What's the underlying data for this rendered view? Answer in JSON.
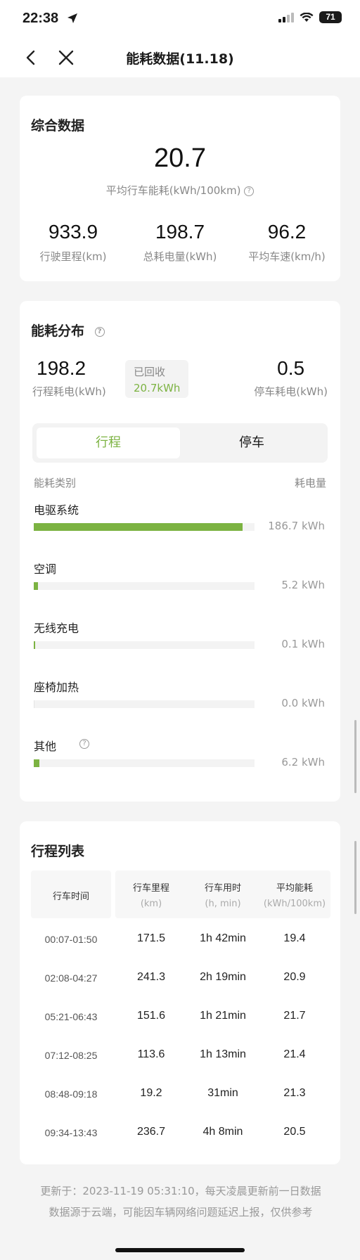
{
  "status": {
    "time": "22:38",
    "battery": "71"
  },
  "nav": {
    "title": "能耗数据(11.18)"
  },
  "summary": {
    "title": "综合数据",
    "avg_value": "20.7",
    "avg_label": "平均行车能耗(kWh/100km)",
    "stats": [
      {
        "value": "933.9",
        "label": "行驶里程(km)"
      },
      {
        "value": "198.7",
        "label": "总耗电量(kWh)"
      },
      {
        "value": "96.2",
        "label": "平均车速(km/h)"
      }
    ]
  },
  "distribution": {
    "title": "能耗分布",
    "drive_value": "198.2",
    "drive_label": "行程耗电(kWh)",
    "recycled_label": "已回收",
    "recycled_value": "20.7kWh",
    "park_value": "0.5",
    "park_label": "停车耗电(kWh)",
    "tabs": [
      "行程",
      "停车"
    ],
    "col_category": "能耗类别",
    "col_consumption": "耗电量",
    "items": [
      {
        "name": "电驱系统",
        "value": "186.7 kWh",
        "fill": 0.945
      },
      {
        "name": "空调",
        "value": "5.2 kWh",
        "fill": 0.02
      },
      {
        "name": "无线充电",
        "value": "0.1 kWh",
        "fill": 0.003
      },
      {
        "name": "座椅加热",
        "value": "0.0 kWh",
        "fill": 0
      },
      {
        "name": "其他",
        "value": "6.2 kWh",
        "fill": 0.024
      }
    ]
  },
  "trips": {
    "title": "行程列表",
    "headers": [
      {
        "main": "行车时间",
        "sub": ""
      },
      {
        "main": "行车里程",
        "sub": "(km)"
      },
      {
        "main": "行车用时",
        "sub": "(h, min)"
      },
      {
        "main": "平均能耗",
        "sub": "(kWh/100km)"
      }
    ],
    "rows": [
      [
        "00:07-01:50",
        "171.5",
        "1h 42min",
        "19.4"
      ],
      [
        "02:08-04:27",
        "241.3",
        "2h 19min",
        "20.9"
      ],
      [
        "05:21-06:43",
        "151.6",
        "1h 21min",
        "21.7"
      ],
      [
        "07:12-08:25",
        "113.6",
        "1h 13min",
        "21.4"
      ],
      [
        "08:48-09:18",
        "19.2",
        "31min",
        "21.3"
      ],
      [
        "09:34-13:43",
        "236.7",
        "4h 8min",
        "20.5"
      ]
    ]
  },
  "footer": {
    "line1": "更新于：2023-11-19 05:31:10，每天凌晨更新前一日数据",
    "line2": "数据源于云端，可能因车辆网络问题延迟上报，仅供参考"
  },
  "colors": {
    "accent": "#7cb342",
    "background": "#f4f4f4"
  }
}
